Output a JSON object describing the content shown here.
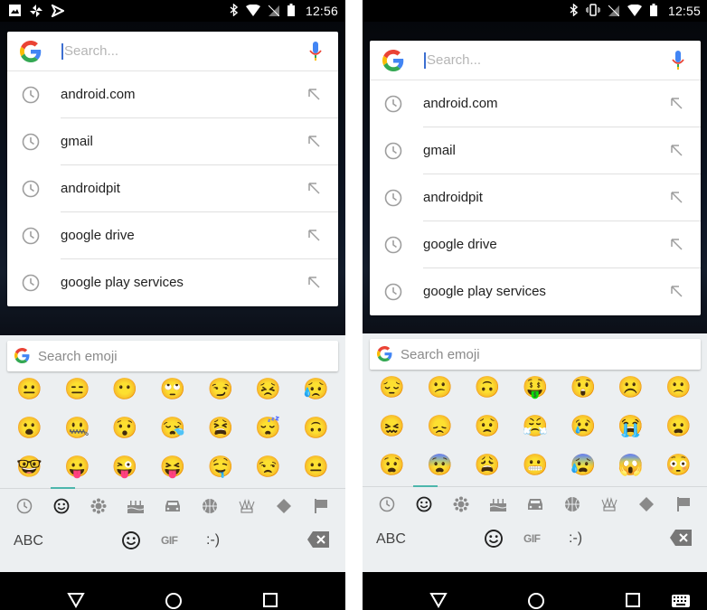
{
  "screens": [
    {
      "id": "left",
      "status_bar": {
        "left_icons": [
          "image-icon",
          "pinwheel-icon",
          "checkmark-flag-icon"
        ],
        "right_icons": [
          "bluetooth-icon",
          "wifi-icon",
          "no-sim-icon",
          "battery-icon"
        ],
        "time": "12:56"
      },
      "search": {
        "placeholder": "Search...",
        "history": [
          "android.com",
          "gmail",
          "androidpit",
          "google drive",
          "google play services"
        ]
      },
      "keyboard": {
        "emoji_search_placeholder": "Search emoji",
        "emoji_grid": [
          "😐",
          "😑",
          "😶",
          "🙄",
          "😏",
          "😣",
          "😥",
          "😮",
          "🤐",
          "😯",
          "😪",
          "😫",
          "😴",
          "🙃",
          "🤓",
          "😛",
          "😜",
          "😝",
          "🤤",
          "😒",
          "😐"
        ],
        "categories": [
          "recent-clock-icon",
          "smiley-icon",
          "nature-icon",
          "cake-food-icon",
          "car-icon",
          "basketball-icon",
          "crown-objects-icon",
          "diamond-symbols-icon",
          "flag-icon"
        ],
        "active_category": 1,
        "abc_label": "ABC",
        "gif_label": "GIF",
        "emoticon_label": ":-)"
      },
      "nav": [
        "back-icon",
        "home-icon",
        "recents-icon"
      ]
    },
    {
      "id": "right",
      "status_bar": {
        "left_icons": [],
        "right_icons": [
          "bluetooth-icon",
          "vibrate-icon",
          "no-sim-icon",
          "wifi-icon",
          "battery-icon"
        ],
        "time": "12:55"
      },
      "search": {
        "placeholder": "Search...",
        "history": [
          "android.com",
          "gmail",
          "androidpit",
          "google drive",
          "google play services"
        ]
      },
      "keyboard": {
        "emoji_search_placeholder": "Search emoji",
        "emoji_grid": [
          "😔",
          "😕",
          "🙃",
          "🤑",
          "😲",
          "☹️",
          "🙁",
          "😖",
          "😞",
          "😟",
          "😤",
          "😢",
          "😭",
          "😦",
          "😧",
          "😨",
          "😩",
          "😬",
          "😰",
          "😱",
          "😳"
        ],
        "categories": [
          "recent-clock-icon",
          "smiley-icon",
          "nature-icon",
          "cake-food-icon",
          "car-icon",
          "basketball-icon",
          "crown-objects-icon",
          "diamond-symbols-icon",
          "flag-icon"
        ],
        "active_category": 1,
        "abc_label": "ABC",
        "gif_label": "GIF",
        "emoticon_label": ":-)"
      },
      "nav": [
        "back-icon",
        "home-icon",
        "recents-icon",
        "keyboard-switch-icon"
      ]
    }
  ],
  "colors": {
    "accent_teal": "#4db6ac",
    "keyboard_bg": "#eceff1",
    "cursor_blue": "#3d6fd1"
  }
}
